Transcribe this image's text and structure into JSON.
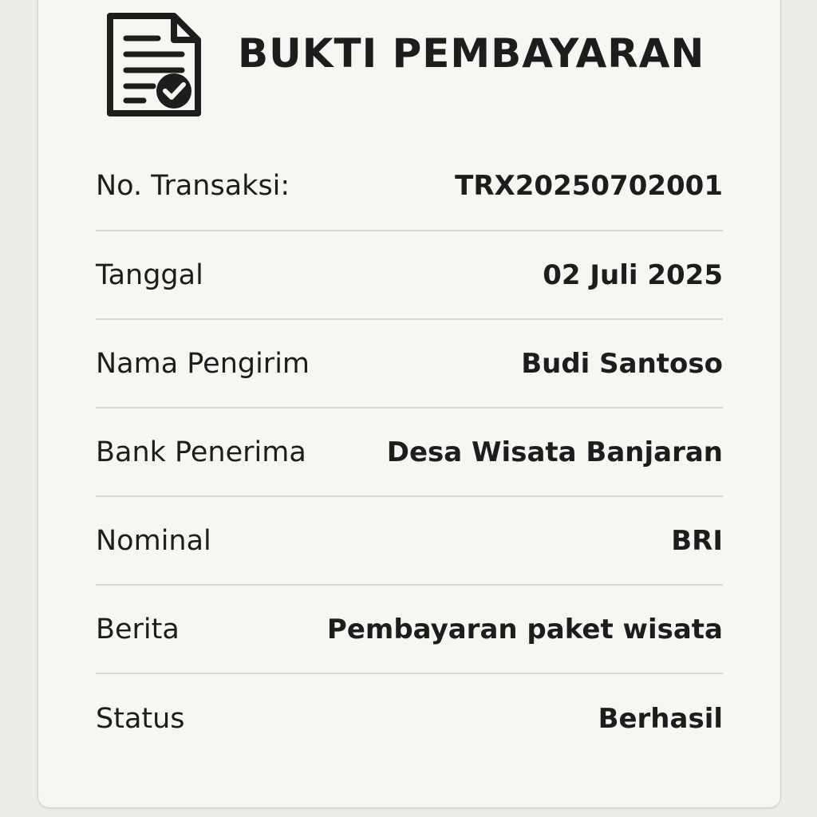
{
  "receipt": {
    "title": "BUKTI PEMBAYARAN",
    "icon": "document-check-icon",
    "rows": [
      {
        "label": "No. Transaksi:",
        "value": "TRX20250702001"
      },
      {
        "label": "Tanggal",
        "value": "02 Juli 2025"
      },
      {
        "label": "Nama Pengirim",
        "value": "Budi Santoso"
      },
      {
        "label": "Bank Penerima",
        "value": "Desa Wisata Banjaran"
      },
      {
        "label": "Nominal",
        "value": "BRI"
      },
      {
        "label": "Berita",
        "value": "Pembayaran paket wisata"
      },
      {
        "label": "Status",
        "value": "Berhasil"
      }
    ]
  },
  "colors": {
    "background": "#efedea",
    "card": "#f8f6f3",
    "text": "#1d1d1d",
    "divider": "#d9d7d4"
  }
}
